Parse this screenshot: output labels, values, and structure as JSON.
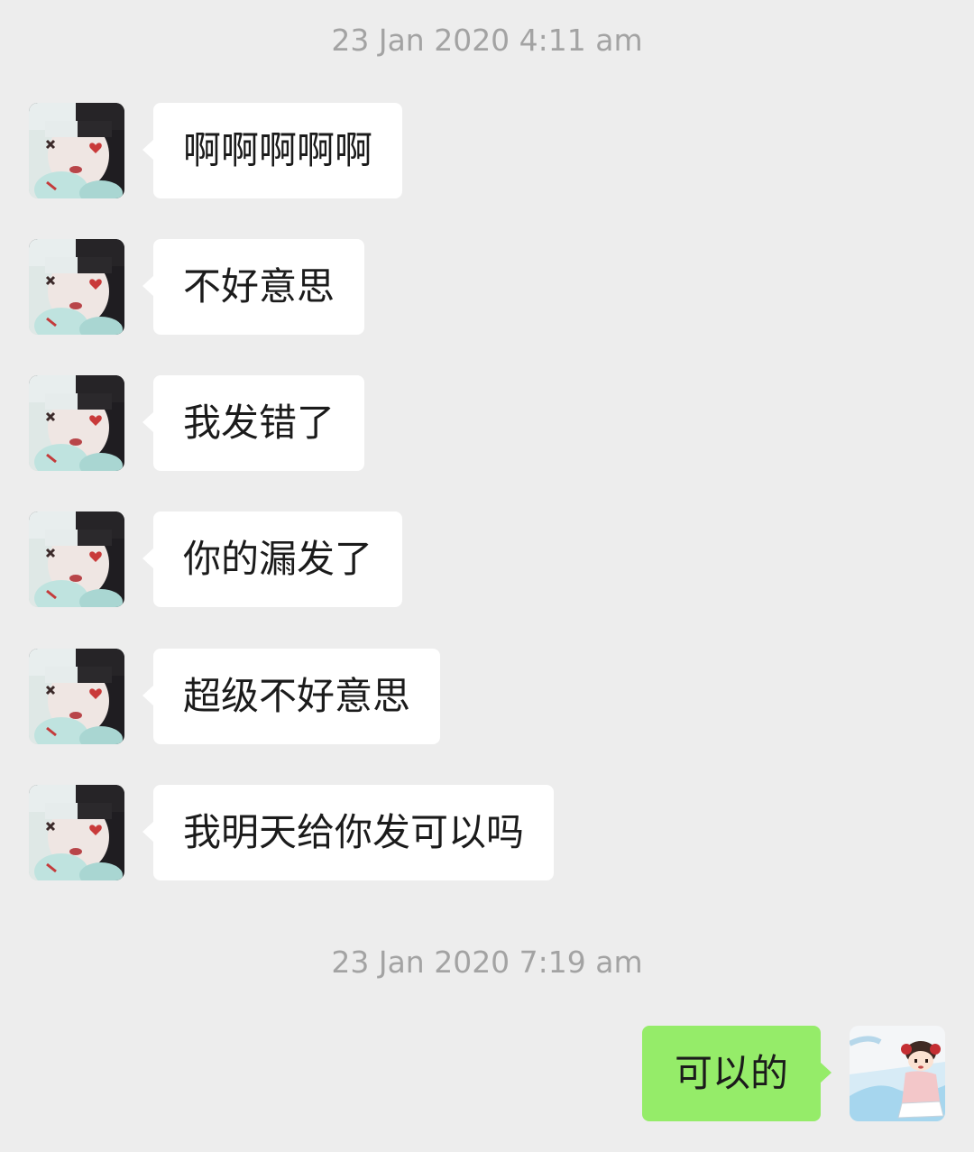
{
  "timestamps": {
    "first": "23 Jan 2020 4:11 am",
    "second": "23 Jan 2020 7:19 am"
  },
  "contact": {
    "avatar_icon": "contact-avatar-photo",
    "messages": [
      "啊啊啊啊啊",
      "不好意思",
      "我发错了",
      "你的漏发了",
      "超级不好意思",
      "我明天给你发可以吗"
    ]
  },
  "me": {
    "avatar_icon": "cartoon-girl-avatar",
    "message": "可以的"
  },
  "colors": {
    "background": "#ededed",
    "incoming_bubble": "#ffffff",
    "outgoing_bubble": "#95ec69",
    "timestamp_text": "#a3a3a3"
  }
}
